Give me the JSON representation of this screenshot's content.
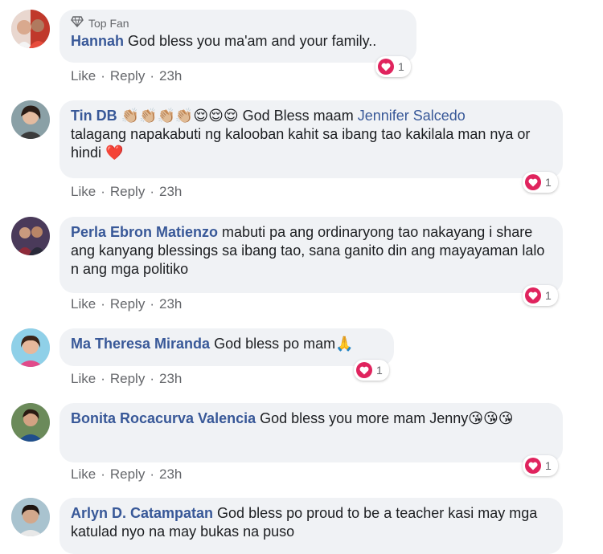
{
  "actions": {
    "like": "Like",
    "reply": "Reply",
    "separator": "·"
  },
  "heart_color": "#e0245e",
  "link_color": "#385898",
  "comments": [
    {
      "badge": "Top Fan",
      "name": "Hannah",
      "text": "God bless you ma'am and your family..",
      "time": "23h",
      "reactions": "1"
    },
    {
      "name": "Tin DB",
      "emoji_text": "👏🏼👏🏼👏🏼👏🏼😌😌😌",
      "text_before_mention": "God Bless maam",
      "mention": "Jennifer Salcedo",
      "text_after_mention": "talagang napakabuti ng kalooban kahit sa ibang tao kakilala man nya or hindi",
      "trailing_emoji": "❤️",
      "time": "23h",
      "reactions": "1"
    },
    {
      "name": "Perla Ebron Matienzo",
      "text": "mabuti pa ang ordinaryong tao nakayang i share ang kanyang blessings sa ibang tao, sana ganito din ang mayayaman lalo n ang mga politiko",
      "time": "23h",
      "reactions": "1"
    },
    {
      "name": "Ma Theresa Miranda",
      "text": "God bless po mam",
      "trailing_emoji": "🙏",
      "time": "23h",
      "reactions": "1"
    },
    {
      "name": "Bonita Rocacurva Valencia",
      "text": "God bless you more mam Jenny",
      "trailing_emoji": "😘😘😘",
      "time": "23h",
      "reactions": "1"
    },
    {
      "name": "Arlyn D. Catampatan",
      "text": "God bless po proud to be a teacher kasi may mga katulad nyo na may bukas na puso"
    }
  ]
}
